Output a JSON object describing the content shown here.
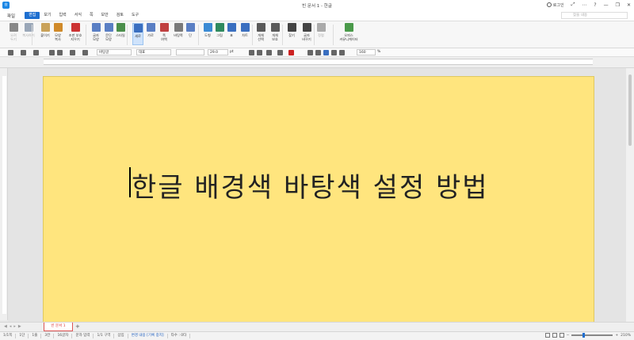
{
  "window": {
    "title": "빈 문서 1 - 한글",
    "login": "로그인",
    "controls": [
      "⤢",
      "⋯",
      "?",
      "—",
      "❐",
      "✕"
    ]
  },
  "menu": {
    "file": "파일",
    "items": [
      {
        "label": "편집",
        "active": true
      },
      {
        "label": "보기"
      },
      {
        "label": "입력"
      },
      {
        "label": "서식"
      },
      {
        "label": "쪽"
      },
      {
        "label": "보안"
      },
      {
        "label": "검토"
      },
      {
        "label": "도구"
      }
    ],
    "search_placeholder": "찾을 내용"
  },
  "ribbon": {
    "buttons": [
      {
        "label": "오려\n두기",
        "dim": true
      },
      {
        "label": "복사하기",
        "dim": true
      },
      {
        "label": "붙이기",
        "dim": false
      },
      {
        "label": "모양\n복사",
        "dim": false
      },
      {
        "label": "조판 부호\n지우기",
        "dim": false
      },
      {
        "label": "글자\n모양",
        "dim": false
      },
      {
        "label": "문단\n모양",
        "dim": false
      },
      {
        "label": "스타일",
        "dim": false
      },
      {
        "label": "세로",
        "dim": false,
        "selected": true
      },
      {
        "label": "가로",
        "dim": false
      },
      {
        "label": "쪽\n여백",
        "dim": false
      },
      {
        "label": "바탕쪽",
        "dim": false
      },
      {
        "label": "단",
        "dim": false
      },
      {
        "label": "도형",
        "dim": false
      },
      {
        "label": "그림",
        "dim": false
      },
      {
        "label": "표",
        "dim": false
      },
      {
        "label": "차트",
        "dim": false
      },
      {
        "label": "개체\n선택",
        "dim": false
      },
      {
        "label": "개체\n보호",
        "dim": false
      },
      {
        "label": "찾기",
        "dim": false
      },
      {
        "label": "글자\n바꾸기",
        "dim": false
      },
      {
        "label": "정렬",
        "dim": true
      },
      {
        "label": "오피스\n커뮤니케이터",
        "dim": false
      }
    ],
    "icon_colors": [
      "#888888",
      "#9aa7b8",
      "#c9a25a",
      "#d08a2a",
      "#cc3333",
      "#5a7fc4",
      "#5a7fc4",
      "#4b8f4b",
      "#3a6fc0",
      "#5a7fc4",
      "#c04040",
      "#7a7a7a",
      "#5a7fc4",
      "#3b8bd4",
      "#2f8a5f",
      "#3a6fc0",
      "#3a6fc0",
      "#5a5a5a",
      "#5a5a5a",
      "#444444",
      "#444444",
      "#aaaaaa",
      "#4a9a4a"
    ]
  },
  "formatbar": {
    "style": "바탕글",
    "lang": "대표",
    "font": "",
    "size": "29.0",
    "unit": "pt",
    "zoom": "160",
    "zoom_unit": "%"
  },
  "document": {
    "text": "한글 배경색 바탕색 설정 방법",
    "background": "#ffe57e"
  },
  "tabs": {
    "active": "빈 문서 1",
    "add": "+"
  },
  "status": {
    "items": [
      "1/1쪽",
      "1단",
      "1줄",
      "3칸",
      "16글자",
      "문자 입력",
      "1/1 구역",
      "삽입"
    ],
    "track": "변경 내용 [기록 중지]",
    "words": "타수 : 0타",
    "zoom": "210%"
  }
}
